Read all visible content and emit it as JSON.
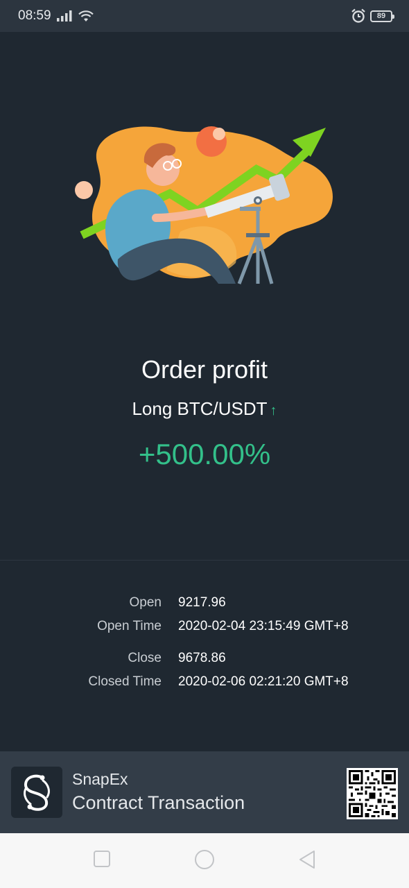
{
  "status_bar": {
    "time": "08:59",
    "battery": "89",
    "icons": [
      "signal-icon",
      "wifi-icon",
      "alarm-icon",
      "battery-icon"
    ]
  },
  "order": {
    "title": "Order profit",
    "direction": "Long",
    "pair": "BTC/USDT",
    "arrow": "↑",
    "profit": "+500.00%",
    "profit_color": "#33c08a"
  },
  "details": {
    "open_label": "Open",
    "open_value": "9217.96",
    "open_time_label": "Open Time",
    "open_time_value": "2020-02-04 23:15:49 GMT+8",
    "close_label": "Close",
    "close_value": "9678.86",
    "closed_time_label": "Closed Time",
    "closed_time_value": "2020-02-06 02:21:20 GMT+8"
  },
  "footer": {
    "brand": "SnapEx",
    "subtitle": "Contract Transaction"
  },
  "colors": {
    "background": "#1f2831",
    "accent_green": "#33c08a",
    "illustration_orange": "#f5a53a",
    "arrow_green": "#7ed321"
  },
  "navbar": {
    "icons": [
      "recent-apps-icon",
      "home-icon",
      "back-icon"
    ]
  }
}
